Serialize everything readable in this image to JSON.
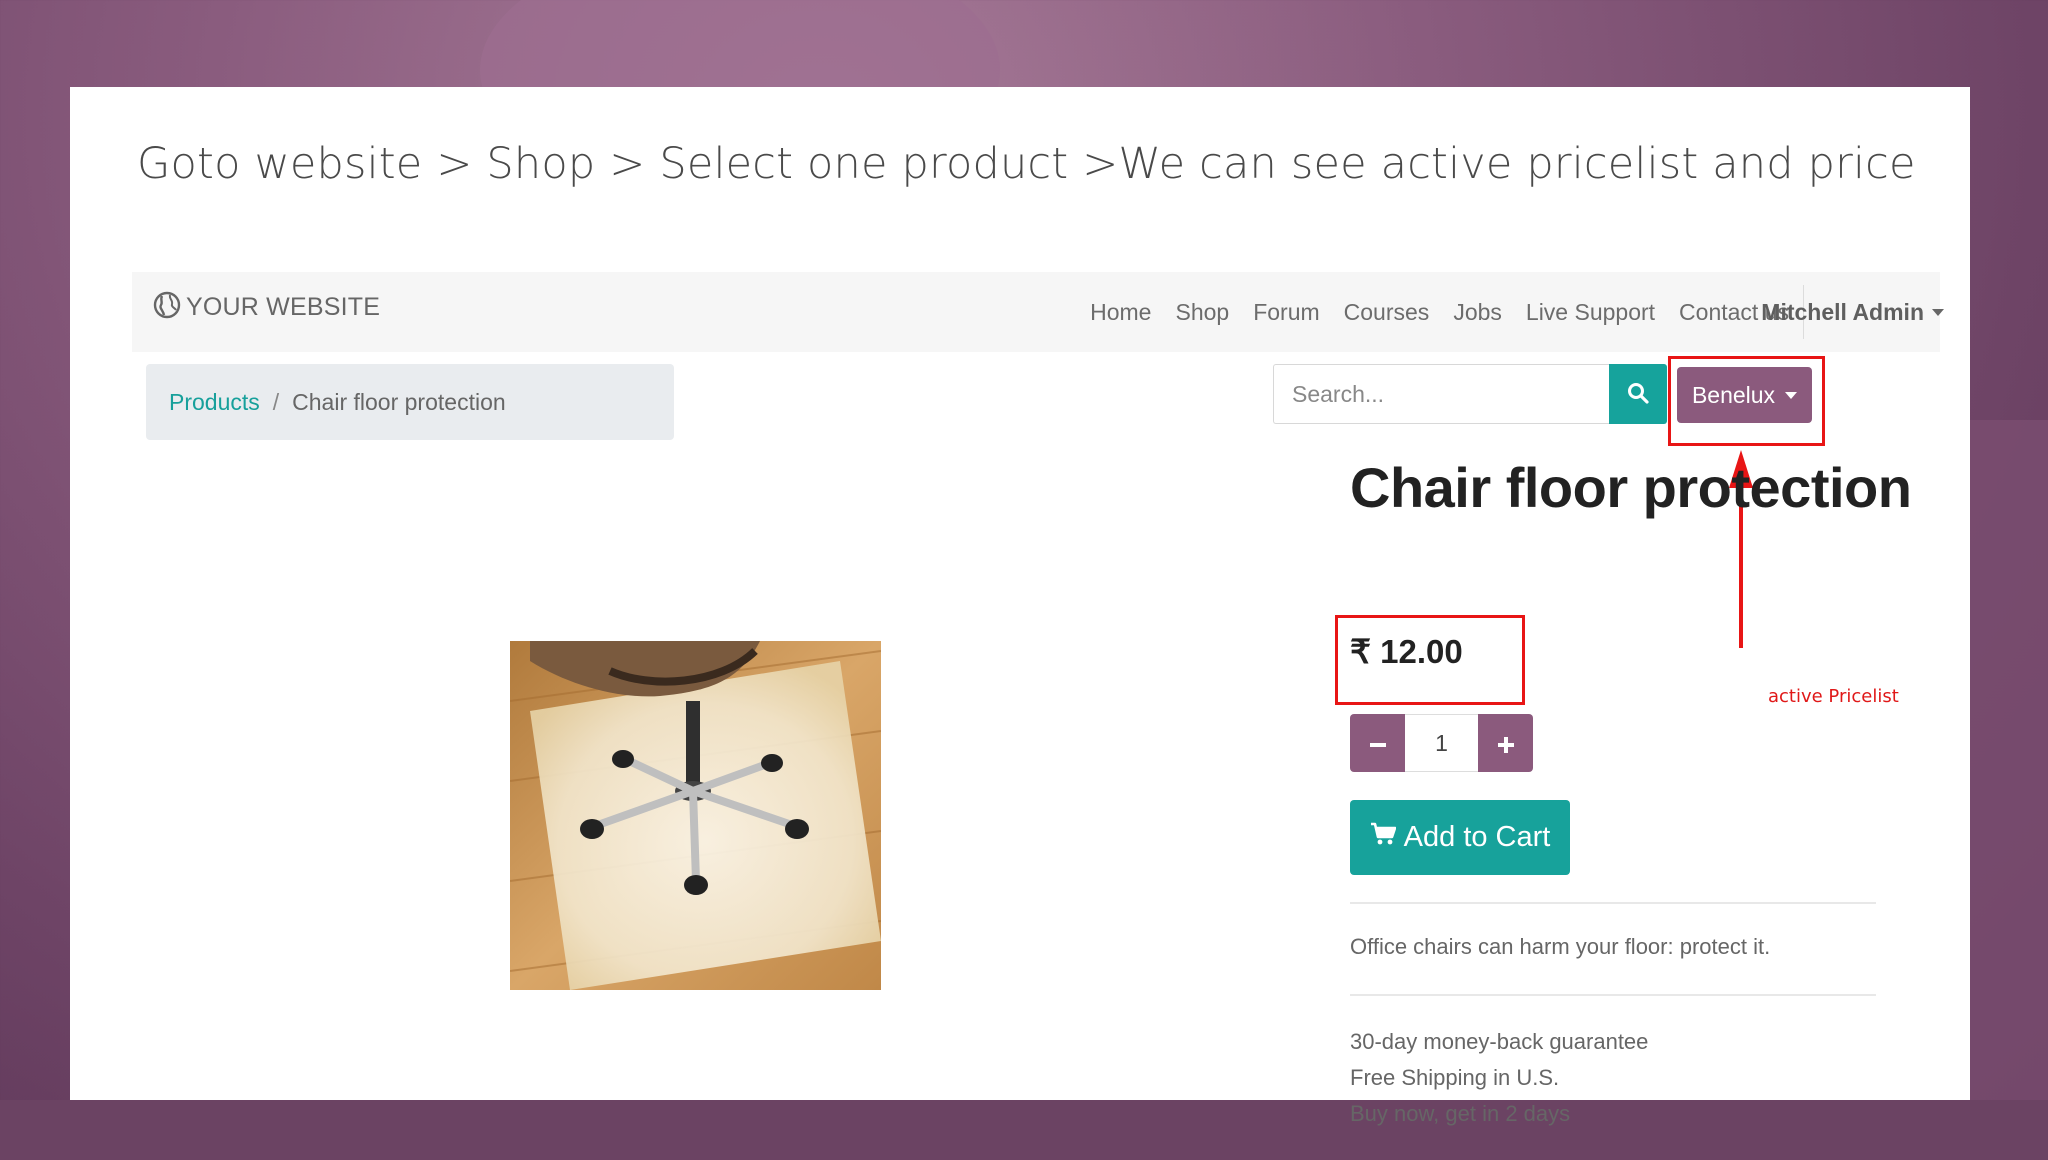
{
  "slide": {
    "title": "Goto website > Shop > Select one product >We can see active pricelist and price"
  },
  "navbar": {
    "brand": "YOUR WEBSITE",
    "links": [
      "Home",
      "Shop",
      "Forum",
      "Courses",
      "Jobs",
      "Live Support",
      "Contact us"
    ],
    "user": "Mitchell Admin"
  },
  "breadcrumb": {
    "parent": "Products",
    "separator": "/",
    "current": "Chair floor protection"
  },
  "search": {
    "placeholder": "Search..."
  },
  "pricelist": {
    "selected": "Benelux"
  },
  "annotation": {
    "label": "active Pricelist",
    "color": "#e81515"
  },
  "product": {
    "name": "Chair floor protection",
    "price": "₹ 12.00",
    "quantity": "1",
    "add_to_cart": "Add to Cart",
    "description": "Office chairs can harm your floor: protect it.",
    "features": [
      "30-day money-back guarantee",
      "Free Shipping in U.S.",
      "Buy now, get in 2 days"
    ]
  },
  "colors": {
    "primary": "#8b5a7d",
    "accent": "#16a39c"
  },
  "icons": {
    "brand": "globe-icon",
    "search": "search-icon",
    "cart": "cart-icon",
    "minus": "minus-icon",
    "plus": "plus-icon"
  }
}
